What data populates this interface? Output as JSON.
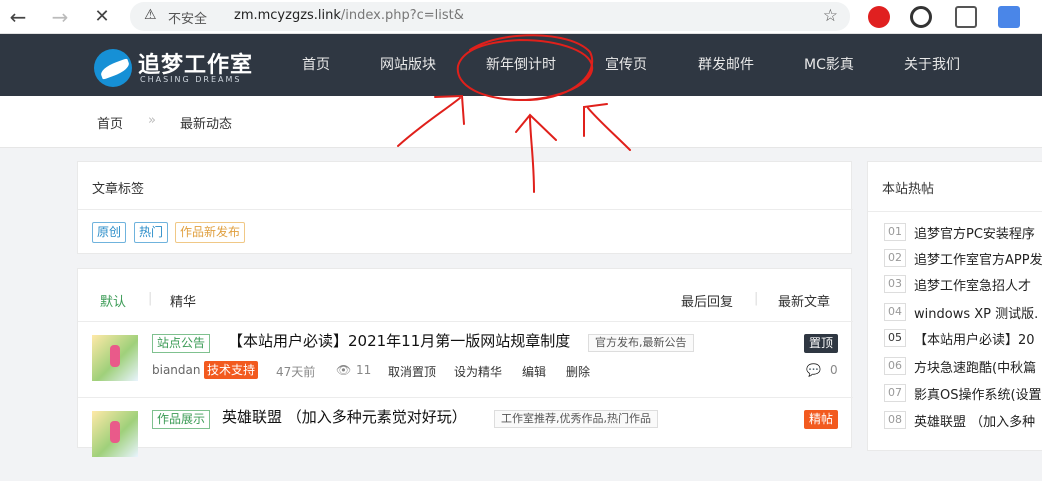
{
  "browser": {
    "back": "←",
    "forward": "→",
    "reload": "✕",
    "security_icon": "warning-icon",
    "insecure_label": "不安全",
    "url_host": "zm.mcyzgzs.link",
    "url_path": "/index.php?c=list&"
  },
  "header": {
    "logo_text": "追梦工作室",
    "logo_sub": "CHASING DREAMS",
    "menu": [
      "首页",
      "网站版块",
      "新年倒计时",
      "宣传页",
      "群发邮件",
      "MC影真",
      "关于我们"
    ]
  },
  "breadcrumb": {
    "home": "首页",
    "sep": "»",
    "current": "最新动态"
  },
  "tags_panel": {
    "title": "文章标签",
    "tags": [
      "原创",
      "热门",
      "作品新发布"
    ]
  },
  "list": {
    "tabs": {
      "default": "默认",
      "featured": "精华",
      "latest_reply": "最后回复",
      "latest_article": "最新文章"
    },
    "posts": [
      {
        "category": "站点公告",
        "title": "【本站用户必读】2021年11月第一版网站规章制度",
        "chips": "官方发布,最新公告",
        "author": "biandan",
        "role": "技术支持",
        "time": "47天前",
        "views": "11",
        "actions": [
          "取消置顶",
          "设为精华",
          "编辑",
          "删除"
        ],
        "badge": "置顶",
        "comments": "0"
      },
      {
        "category": "作品展示",
        "title": "英雄联盟 （加入多种元素觉对好玩）",
        "chips": "工作室推荐,优秀作品,热门作品",
        "badge": "精帖"
      }
    ]
  },
  "hot_panel": {
    "title": "本站热帖",
    "items": [
      {
        "num": "01",
        "text": "追梦官方PC安装程序"
      },
      {
        "num": "02",
        "text": "追梦工作室官方APP发"
      },
      {
        "num": "03",
        "text": "追梦工作室急招人才"
      },
      {
        "num": "04",
        "text": "windows XP 测试版."
      },
      {
        "num": "05",
        "text": "【本站用户必读】20"
      },
      {
        "num": "06",
        "text": "方块急速跑酷(中秋篇"
      },
      {
        "num": "07",
        "text": "影真OS操作系统(设置"
      },
      {
        "num": "08",
        "text": "英雄联盟 （加入多种"
      }
    ]
  },
  "colors": {
    "header_bg": "#2f3742",
    "annotation": "#e0201b",
    "badge_top": "#2f3742",
    "badge_featured": "#f25a1f",
    "role_badge": "#f25a1f"
  }
}
